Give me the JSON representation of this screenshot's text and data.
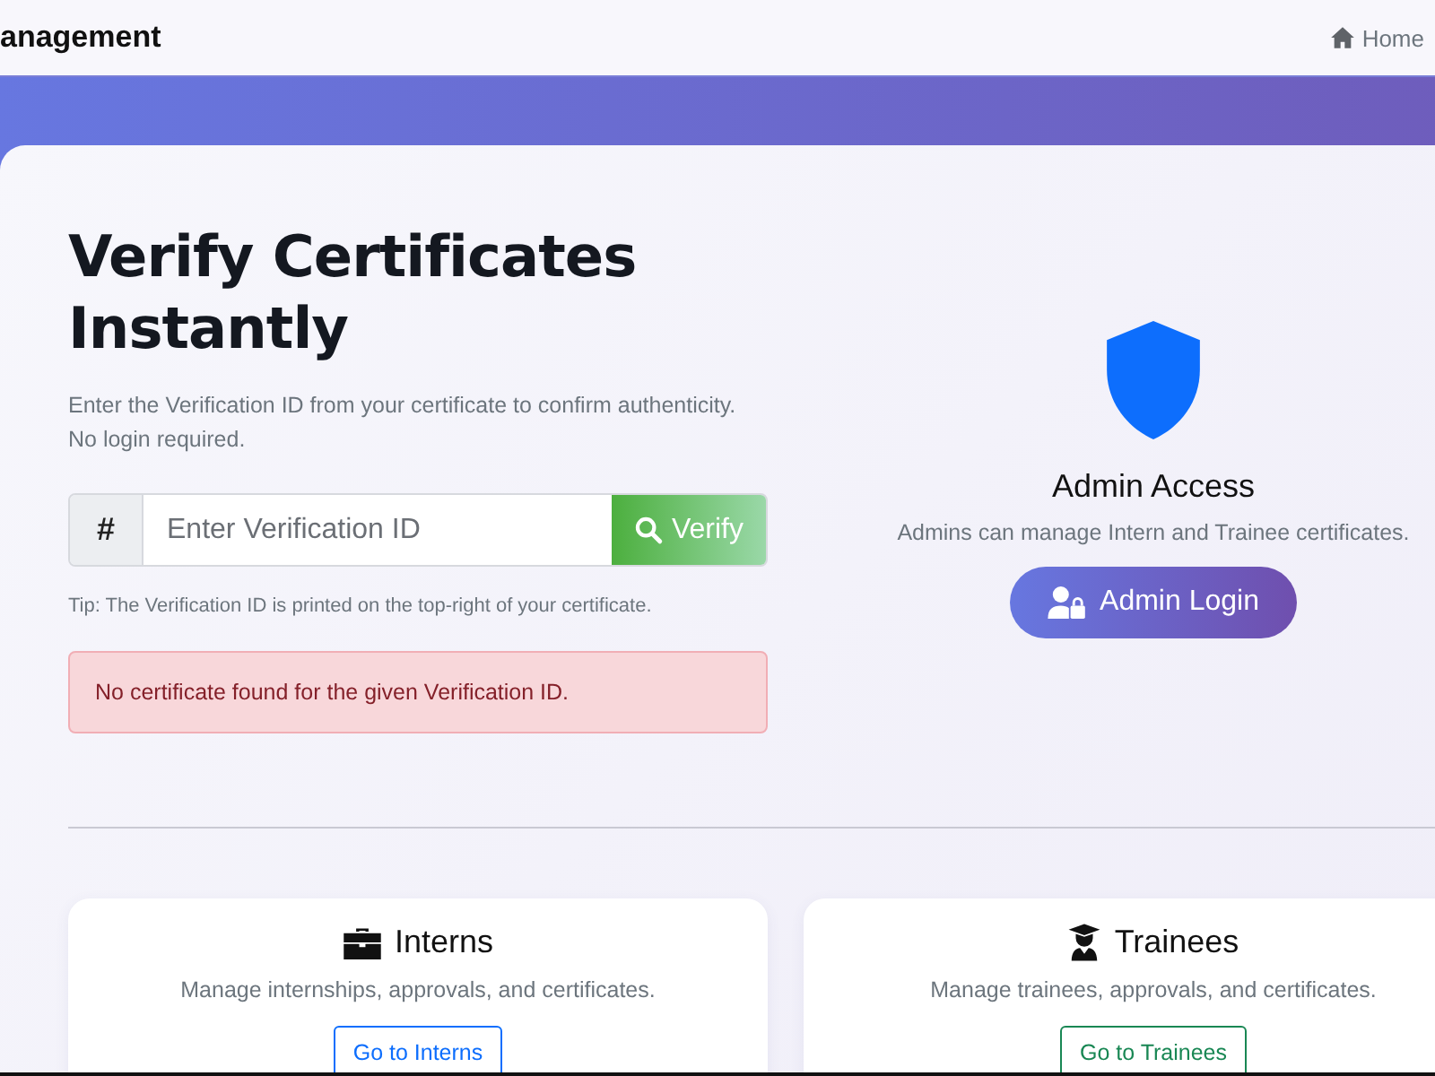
{
  "navbar": {
    "brand": "anagement",
    "home_link": "Home"
  },
  "hero": {
    "title": "Verify Certificates Instantly",
    "description": "Enter the Verification ID from your certificate to confirm authenticity. No login required.",
    "verify_form": {
      "prefix": "#",
      "placeholder": "Enter Verification ID",
      "button": "Verify"
    },
    "tip": "Tip: The Verification ID is printed on the top-right of your certificate.",
    "alert": {
      "kind": "danger",
      "text": "No certificate found for the given Verification ID."
    }
  },
  "admin": {
    "title": "Admin Access",
    "description": "Admins can manage Intern and Trainee certificates.",
    "button": "Admin Login"
  },
  "sections": [
    {
      "kind": "interns",
      "title": "Interns",
      "description": "Manage internships, approvals, and certificates.",
      "button": "Go to Interns"
    },
    {
      "kind": "trainees",
      "title": "Trainees",
      "description": "Manage trainees, approvals, and certificates.",
      "button": "Go to Trainees"
    }
  ]
}
